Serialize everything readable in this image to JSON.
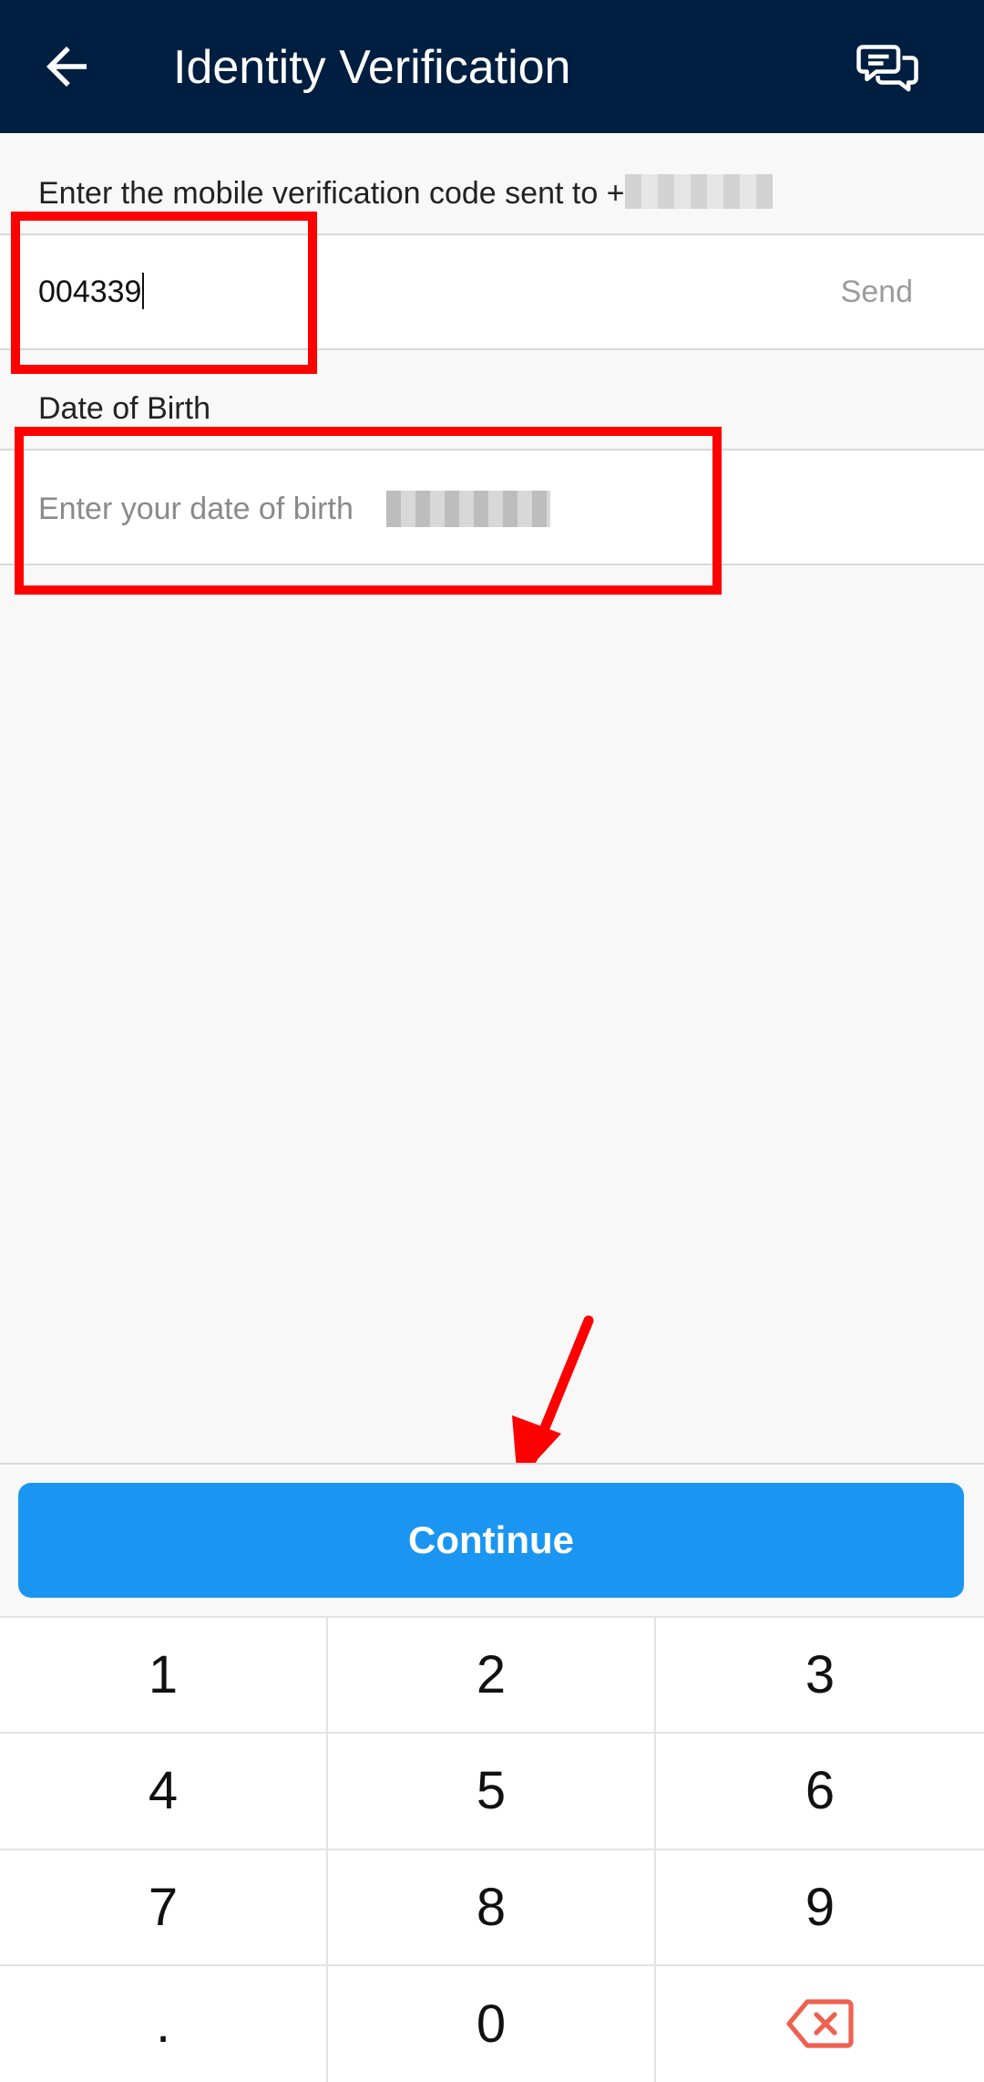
{
  "header": {
    "title": "Identity Verification",
    "back_icon": "arrow-left-icon",
    "chat_icon": "chat-bubbles-icon"
  },
  "verification": {
    "prompt": "Enter the mobile verification code sent to +",
    "code_value": "004339",
    "send_label": "Send"
  },
  "dob": {
    "label": "Date of Birth",
    "placeholder": "Enter your date of birth"
  },
  "continue_label": "Continue",
  "keypad": {
    "keys": [
      "1",
      "2",
      "3",
      "4",
      "5",
      "6",
      "7",
      "8",
      "9",
      ".",
      "0"
    ],
    "delete_icon": "backspace-icon"
  },
  "colors": {
    "appbar": "#001e3f",
    "primary": "#1a96f2",
    "annotation": "#ff0000",
    "delete": "#ee6150"
  }
}
